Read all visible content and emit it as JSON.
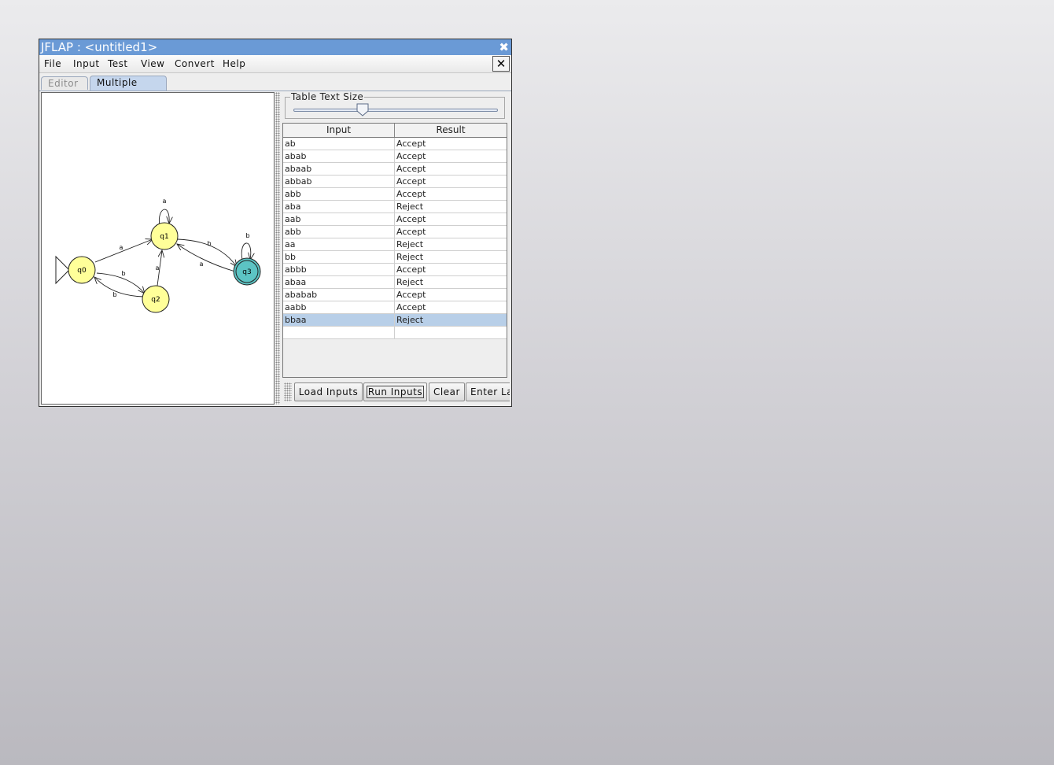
{
  "window": {
    "title": "JFLAP : <untitled1>"
  },
  "menu": [
    "File",
    "Input",
    "Test",
    "View",
    "Convert",
    "Help"
  ],
  "tabs": {
    "editor": "Editor",
    "multiple_run": "Multiple Run"
  },
  "slider": {
    "label": "Table Text Size",
    "value_fraction": 0.34
  },
  "table": {
    "headers": [
      "Input",
      "Result"
    ],
    "rows": [
      [
        "ab",
        "Accept"
      ],
      [
        "abab",
        "Accept"
      ],
      [
        "abaab",
        "Accept"
      ],
      [
        "abbab",
        "Accept"
      ],
      [
        "abb",
        "Accept"
      ],
      [
        "aba",
        "Reject"
      ],
      [
        "aab",
        "Accept"
      ],
      [
        "abb",
        "Accept"
      ],
      [
        "aa",
        "Reject"
      ],
      [
        "bb",
        "Reject"
      ],
      [
        "abbb",
        "Accept"
      ],
      [
        "abaa",
        "Reject"
      ],
      [
        "ababab",
        "Accept"
      ],
      [
        "aabb",
        "Accept"
      ],
      [
        "bbaa",
        "Reject"
      ],
      [
        "",
        ""
      ]
    ],
    "selected_row": 14
  },
  "buttons": {
    "load": "Load Inputs",
    "run": "Run Inputs",
    "clear": "Clear",
    "enter": "Enter La"
  },
  "automaton": {
    "states": {
      "q0": "q0",
      "q1": "q1",
      "q2": "q2",
      "q3": "q3"
    },
    "labels": {
      "q1_loop": "a",
      "q0_q1": "a",
      "q0_q2": "b",
      "q2_q0": "b",
      "q2_q1": "a",
      "q1_q3": "b",
      "q3_q1": "a",
      "q3_loop": "b"
    },
    "initial": "q0",
    "final": [
      "q3"
    ],
    "colors": {
      "state": "#ffff99",
      "final_state": "#5cc4c4"
    }
  }
}
